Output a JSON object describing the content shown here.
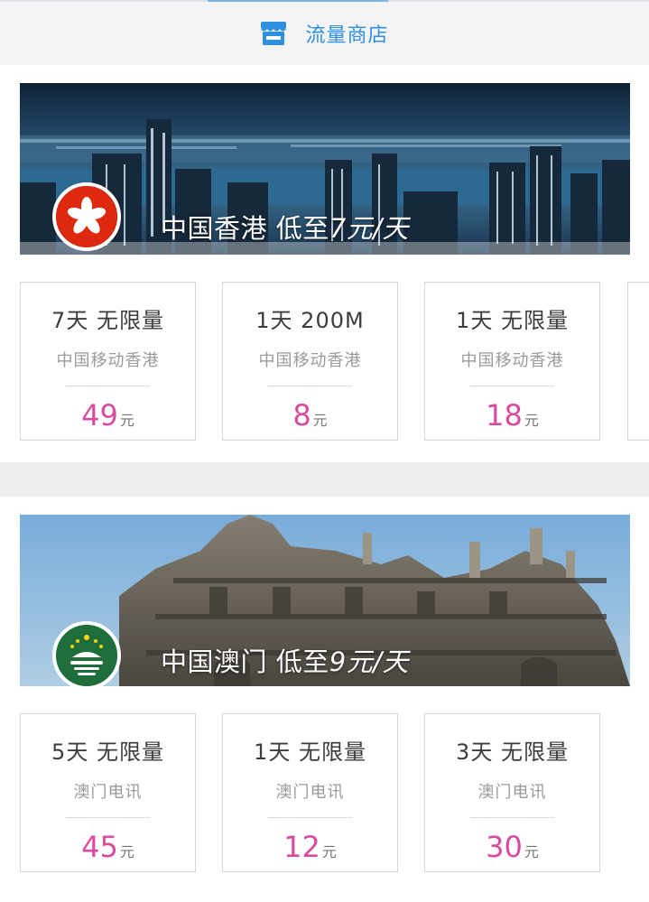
{
  "header": {
    "title": "流量商店",
    "icon": "shop-icon"
  },
  "colors": {
    "accent": "#2f8fe0",
    "price": "#d94b9e",
    "hk_red": "#de2910",
    "macau_green": "#00785e"
  },
  "sections": [
    {
      "region": "中国香港",
      "promo_prefix": "低至",
      "promo_price": "7元/天",
      "flag_icon": "hong-kong-flag-icon",
      "products": [
        {
          "name": "7天 无限量",
          "carrier": "中国移动香港",
          "price": "49",
          "unit": "元"
        },
        {
          "name": "1天 200M",
          "carrier": "中国移动香港",
          "price": "8",
          "unit": "元"
        },
        {
          "name": "1天 无限量",
          "carrier": "中国移动香港",
          "price": "18",
          "unit": "元"
        }
      ]
    },
    {
      "region": "中国澳门",
      "promo_prefix": "低至",
      "promo_price": "9元/天",
      "flag_icon": "macau-flag-icon",
      "products": [
        {
          "name": "5天 无限量",
          "carrier": "澳门电讯",
          "price": "45",
          "unit": "元"
        },
        {
          "name": "1天 无限量",
          "carrier": "澳门电讯",
          "price": "12",
          "unit": "元"
        },
        {
          "name": "3天 无限量",
          "carrier": "澳门电讯",
          "price": "30",
          "unit": "元"
        }
      ]
    }
  ]
}
